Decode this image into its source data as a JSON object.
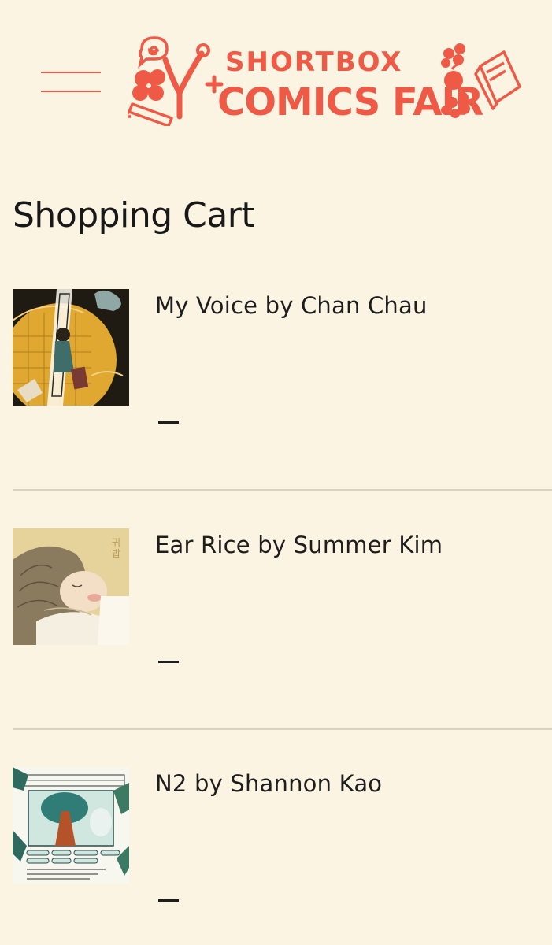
{
  "header": {
    "menu_icon": "hamburger-menu-icon",
    "logo": {
      "line1": "SHORTBOX",
      "line2": "COMICS FAIR",
      "color": "#ef5a47"
    }
  },
  "main": {
    "title": "Shopping Cart"
  },
  "cart": {
    "items": [
      {
        "title": "My Voice by Chan Chau",
        "remove_icon": "minus-icon"
      },
      {
        "title": "Ear Rice by Summer Kim",
        "remove_icon": "minus-icon"
      },
      {
        "title": "N2 by Shannon Kao",
        "remove_icon": "minus-icon"
      }
    ]
  },
  "colors": {
    "background": "#fcf4e2",
    "accent": "#ef5a47",
    "text": "#1c1c1c",
    "divider": "#dad3c3"
  }
}
